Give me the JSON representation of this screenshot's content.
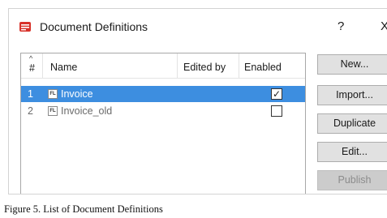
{
  "window": {
    "title": "Document Definitions",
    "help": "?",
    "close": "X",
    "accent_color": "#d8322a"
  },
  "list": {
    "columns": {
      "num": "#",
      "name": "Name",
      "edited_by": "Edited by",
      "enabled": "Enabled"
    },
    "rows": [
      {
        "num": "1",
        "name": "Invoice",
        "icon": "FL",
        "edited_by": "",
        "enabled": true,
        "selected": true
      },
      {
        "num": "2",
        "name": "Invoice_old",
        "icon": "FL",
        "edited_by": "",
        "enabled": false,
        "selected": false
      }
    ],
    "selection_color": "#3d8ee0"
  },
  "buttons": {
    "new": "New...",
    "import": "Import...",
    "duplicate": "Duplicate",
    "edit": "Edit...",
    "publish": "Publish"
  },
  "caption": "Figure 5.  List of Document Definitions"
}
